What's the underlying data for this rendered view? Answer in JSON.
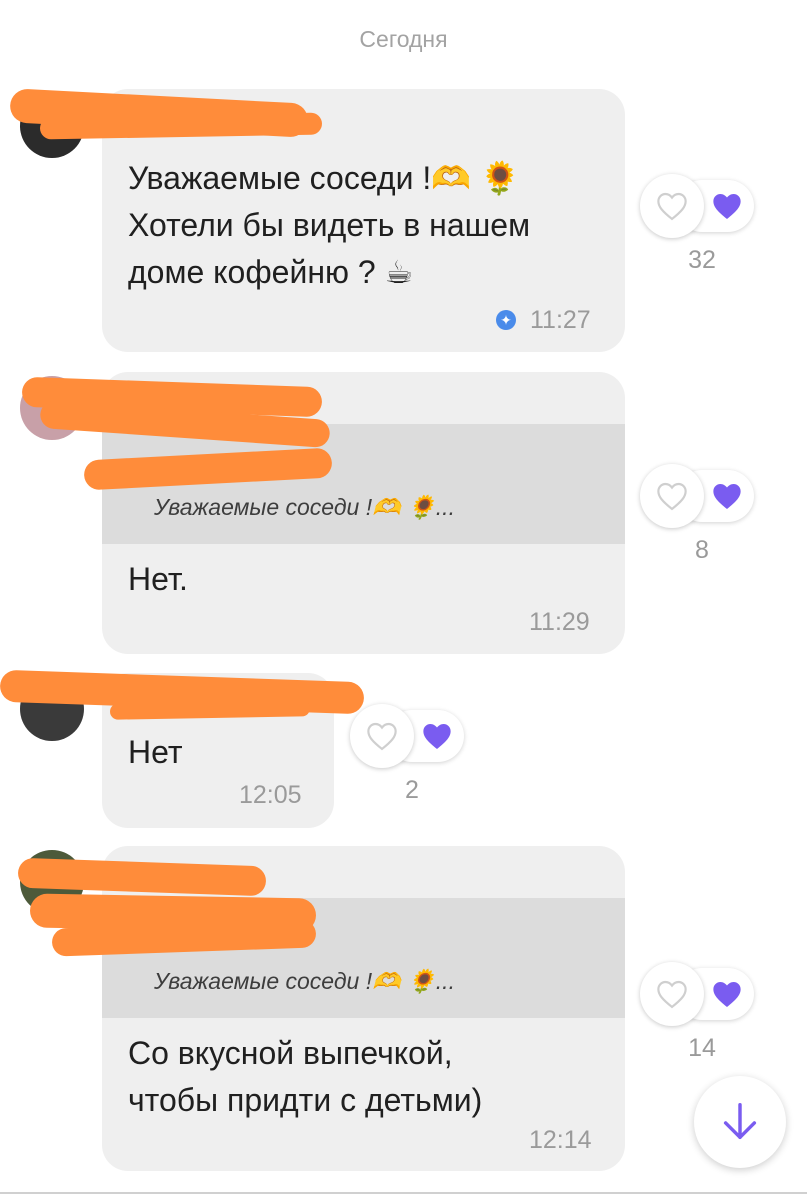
{
  "date_separator": "Сегодня",
  "messages": [
    {
      "text": "Уважаемые соседи !🫶 🌻\nХотели бы видеть в нашем\nдоме кофейню ? ☕",
      "time": "11:27",
      "reactions": {
        "count": "32"
      }
    },
    {
      "quote_text": "Уважаемые соседи !🫶 🌻...",
      "text": "Нет.",
      "time": "11:29",
      "reactions": {
        "count": "8"
      }
    },
    {
      "text": "Нет",
      "time": "12:05",
      "reactions": {
        "count": "2"
      }
    },
    {
      "quote_text": "Уважаемые соседи !🫶 🌻...",
      "text": "Со вкусной выпечкой,\nчтобы придти с детьми)",
      "time": "12:14",
      "reactions": {
        "count": "14"
      }
    }
  ],
  "colors": {
    "bubble": "#efefef",
    "quote": "#dcdcdc",
    "accent_purple": "#7a5cf0",
    "redaction": "#ff8c3a",
    "edited_badge": "#4a8bea"
  },
  "icons": {
    "like": "heart-outline-icon",
    "reaction": "purple-heart-icon",
    "edited": "edited-badge-icon",
    "scroll": "arrow-down-icon"
  }
}
